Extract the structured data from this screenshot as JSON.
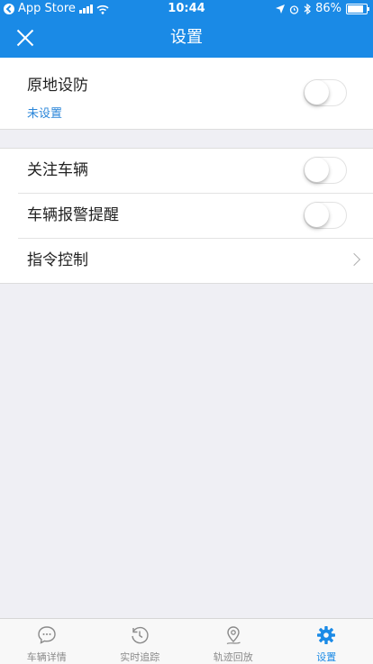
{
  "status_bar": {
    "back_app": "App Store",
    "time": "10:44",
    "battery": "86%",
    "battery_level": 0.86
  },
  "nav": {
    "title": "设置"
  },
  "section1": {
    "label": "原地设防",
    "subtitle": "未设置",
    "toggle_on": false
  },
  "section2": {
    "follow_label": "关注车辆",
    "alarm_label": "车辆报警提醒",
    "command_label": "指令控制"
  },
  "tabs": [
    {
      "label": "车辆详情",
      "icon": "chat-bubble-icon"
    },
    {
      "label": "实时追踪",
      "icon": "clock-history-icon"
    },
    {
      "label": "轨迹回放",
      "icon": "location-track-icon"
    },
    {
      "label": "设置",
      "icon": "gear-icon"
    }
  ],
  "colors": {
    "brand": "#1a8ae6",
    "link": "#2a86d9"
  }
}
